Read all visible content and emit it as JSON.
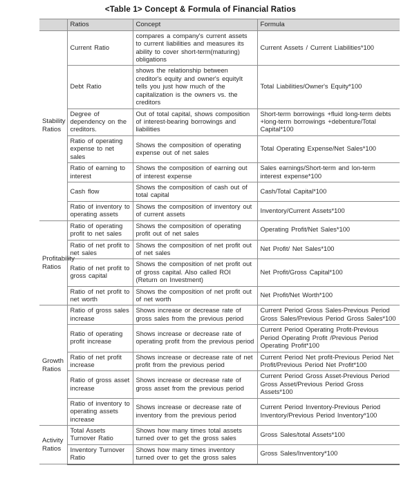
{
  "document": {
    "title": "<Table 1> Concept & Formula of Financial Ratios"
  },
  "table": {
    "headers": {
      "group": "",
      "ratios": "Ratios",
      "concept": "Concept",
      "formula": "Formula"
    },
    "groups": [
      {
        "name_lines": [
          "Stability",
          "Ratios"
        ],
        "rows": [
          {
            "ratio": "Current Ratio",
            "concept": "compares a company's current assets to current liabilities and measures its ability to cover short-term(maturing) obligations",
            "formula": "Current Assets / Current Liabilities*100"
          },
          {
            "ratio": "Debt Ratio",
            "concept": "shows the relationship between creditor's equity and owner's equityIt tells you just how much of the capitalization is the owners vs. the creditors",
            "formula": "Total Liabilities/Owner's Equity*100"
          },
          {
            "ratio": "Degree of dependency on the creditors.",
            "concept": "Out of total capital, shows composition of interest-bearing borrowings and liabilities",
            "formula": "Short-term borrowings +fluid long-term debts +long-term borrowings +debenture/Total Capital*100"
          },
          {
            "ratio": "Ratio of operating expense to net sales",
            "concept": "Shows the composition of operating expense out of net sales",
            "formula": "Total Operating Expense/Net Sales*100"
          },
          {
            "ratio": "Ratio of earning to interest",
            "concept": "Shows the composition of earning out of interest expense",
            "formula": "Sales earnings/Short-term and lon-term interest expense*100"
          },
          {
            "ratio": "Cash flow",
            "concept": "Shows the composition of cash out of total capital",
            "formula": "Cash/Total Capital*100"
          },
          {
            "ratio": "Ratio of inventory to operating assets",
            "concept": "Shows the composition of inventory out of current assets",
            "formula": "Inventory/Current Assets*100"
          }
        ]
      },
      {
        "name_lines": [
          "Profitability",
          "Ratios"
        ],
        "rows": [
          {
            "ratio": "Ratio of operating profit to net sales",
            "concept": "Shows the composition of operating profit out of net sales",
            "formula": "Operating Profit/Net Sales*100"
          },
          {
            "ratio": "Ratio of net profit to net sales",
            "concept": "Shows the composition of net profit out of net sales",
            "formula": "Net Profit/ Net Sales*100"
          },
          {
            "ratio": "Ratio of net profit to gross capital",
            "concept": "Shows the composition of net profit out of gross capital. Also called ROI (Return on Investment)",
            "formula": "Net Profit/Gross Capital*100"
          },
          {
            "ratio": "Ratio of net profit to net worth",
            "concept": "Shows the composition of net profit out of net worth",
            "formula": "Net Profit/Net Worth*100"
          }
        ]
      },
      {
        "name_lines": [
          "Growth",
          "Ratios"
        ],
        "rows": [
          {
            "ratio": "Ratio of gross sales increase",
            "concept": "Shows increase or decrease rate of gross sales from the previous period",
            "formula": "Current Period Gross Sales-Previous Period Gross Sales/Previous Period Gross Sales*100"
          },
          {
            "ratio": "Ratio of operating profit increase",
            "concept": "Shows increase or decrease rate of operating profit from the previous period",
            "formula": "Current Period Operating Profit-Previous Period Operating Profit /Previous Period Operating Profit*100"
          },
          {
            "ratio": "Ratio of net profit increase",
            "concept": "Shows increase or decrease rate of net profit from the previous period",
            "formula": "Current Period Net profit-Previous Period Net Profit/Previous Period Net Profit*100"
          },
          {
            "ratio": "Ratio of gross asset increase",
            "concept": "Shows increase or decrease rate of gross asset from the previous period",
            "formula": "Current Period Gross Asset-Previous Period Gross Asset/Previous Period Gross Assets*100"
          },
          {
            "ratio": "Ratio of inventory to operating assets increase",
            "concept": "Shows increase or decrease rate of inventory from the previous period",
            "formula": "Current Period Inventory-Previous Period Inventory/Previous Period Inventory*100"
          }
        ]
      },
      {
        "name_lines": [
          "Activity",
          "Ratios"
        ],
        "rows": [
          {
            "ratio": "Total Assets Turnover Ratio",
            "concept": "Shows how many times total assets turned over to get the gross sales",
            "formula": "Gross Sales/total Assets*100"
          },
          {
            "ratio": "Inventory Turnover Ratio",
            "concept": "Shows how many times inventory turned over to get the gross sales",
            "formula": "Gross Sales/Inventory*100"
          }
        ]
      }
    ]
  },
  "style": {
    "header_background": "#d8d8d8",
    "border_color": "#8c8c8c",
    "heavy_border_color": "#6e6e6e",
    "text_color": "#262626"
  }
}
